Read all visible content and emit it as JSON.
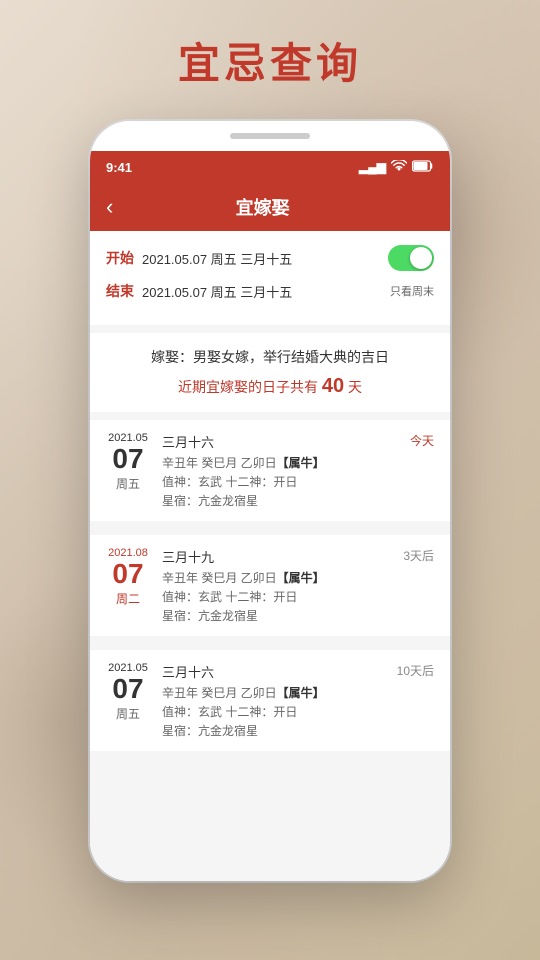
{
  "page": {
    "title": "宜忌查询",
    "background_color": "#e8ddd0"
  },
  "status_bar": {
    "time": "9:41",
    "signal_icon": "▂▄▆",
    "wifi_icon": "wifi",
    "battery_icon": "battery"
  },
  "header": {
    "back_label": "‹",
    "title": "宜嫁娶"
  },
  "date_filter": {
    "start_label": "开始",
    "start_value": "2021.05.07 周五 三月十五",
    "end_label": "结束",
    "end_value": "2021.05.07 周五 三月十五",
    "toggle_label": "只看周末"
  },
  "description": {
    "text": "嫁娶：男娶女嫁，举行结婚大典的吉日",
    "count_prefix": "近期宜嫁娶的日子共有",
    "count_number": "40",
    "count_suffix": "天"
  },
  "list_items": [
    {
      "year_month": "2021.05",
      "day": "07",
      "weekday": "周五",
      "lunar_date": "三月十六",
      "ganzhi": "辛丑年 癸巳月 乙卯日【属牛】",
      "zhishen": "值神：玄武  十二神：开日",
      "star": "星宿：亢金龙宿星",
      "tag": "今天",
      "tag_type": "today",
      "is_red": false
    },
    {
      "year_month": "2021.08",
      "day": "07",
      "weekday": "周二",
      "lunar_date": "三月十九",
      "ganzhi": "辛丑年 癸巳月 乙卯日【属牛】",
      "zhishen": "值神：玄武  十二神：开日",
      "star": "星宿：亢金龙宿星",
      "tag": "3天后",
      "tag_type": "normal",
      "is_red": true
    },
    {
      "year_month": "2021.05",
      "day": "07",
      "weekday": "周五",
      "lunar_date": "三月十六",
      "ganzhi": "辛丑年 癸巳月 乙卯日【属牛】",
      "zhishen": "值神：玄武  十二神：开日",
      "star": "星宿：亢金龙宿星",
      "tag": "10天后",
      "tag_type": "normal",
      "is_red": false
    }
  ]
}
